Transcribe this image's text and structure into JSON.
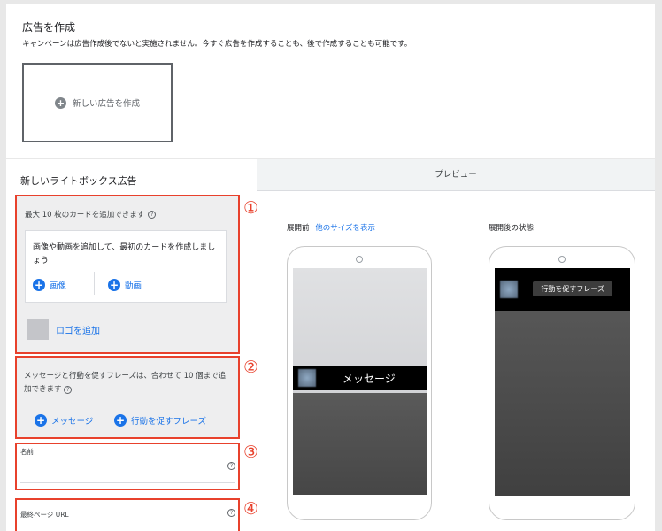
{
  "create_ad": {
    "title": "広告を作成",
    "subtitle": "キャンペーンは広告作成後でないと実施されません。今すぐ広告を作成することも、後で作成することも可能です。",
    "new_ad_label": "新しい広告を作成"
  },
  "editor": {
    "title": "新しいライトボックス広告",
    "cards_section": {
      "label": "最大 10 枚のカードを追加できます",
      "prompt": "画像や動画を追加して、最初のカードを作成しましょう",
      "image_button": "画像",
      "video_button": "動画",
      "logo_button": "ロゴを追加"
    },
    "message_section": {
      "label": "メッセージと行動を促すフレーズは、合わせて 10 個まで追加できます",
      "message_button": "メッセージ",
      "cta_button": "行動を促すフレーズ"
    },
    "name_field": {
      "label": "名前",
      "value": ""
    },
    "url_field": {
      "label": "最終ページ URL",
      "value": ""
    }
  },
  "annotations": [
    "①",
    "②",
    "③",
    "④"
  ],
  "preview": {
    "header": "プレビュー",
    "before_label": "展開前",
    "other_sizes_link": "他のサイズを表示",
    "after_label": "展開後の状態",
    "message_text": "メッセージ",
    "cta_text": "行動を促すフレーズ"
  },
  "colors": {
    "accent": "#1a73e8",
    "annotation_red": "#e8412c",
    "section_gray": "#eeeeef"
  }
}
